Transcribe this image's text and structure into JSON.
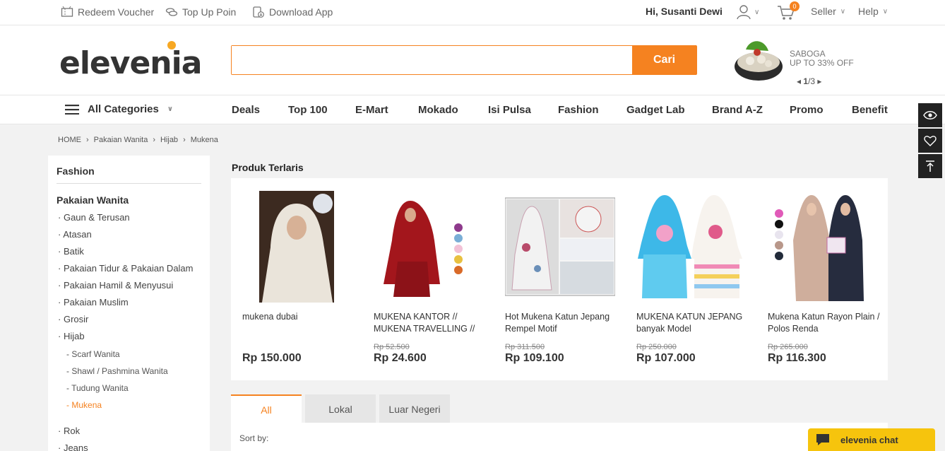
{
  "topbar": {
    "redeem": "Redeem Voucher",
    "topup": "Top Up Poin",
    "download": "Download App",
    "greeting": "Hi, Susanti Dewi",
    "cart_count": "0",
    "seller": "Seller",
    "help": "Help"
  },
  "header": {
    "logo": "eleveni",
    "logo_tail": "a",
    "search_placeholder": "",
    "search_button": "Cari",
    "promo_line1": "SABOGA",
    "promo_line2": "UP TO 33% OFF",
    "promo_page_current": "1",
    "promo_page_total": "/3"
  },
  "nav": {
    "all_categories": "All Categories",
    "links": [
      "Deals",
      "Top 100",
      "E-Mart",
      "Mokado",
      "Isi Pulsa",
      "Fashion",
      "Gadget Lab",
      "Brand A-Z",
      "Promo",
      "Benefit"
    ]
  },
  "breadcrumb": [
    "HOME",
    "Pakaian Wanita",
    "Hijab",
    "Mukena"
  ],
  "sidebar": {
    "title": "Fashion",
    "group": "Pakaian Wanita",
    "items": [
      "Gaun & Terusan",
      "Atasan",
      "Batik",
      "Pakaian Tidur & Pakaian Dalam",
      "Pakaian Hamil & Menyusui",
      "Pakaian Muslim",
      "Grosir",
      "Hijab"
    ],
    "subitems": [
      "Scarf Wanita",
      "Shawl / Pashmina Wanita",
      "Tudung Wanita",
      "Mukena"
    ],
    "more": [
      "Rok",
      "Jeans"
    ]
  },
  "section_title": "Produk Terlaris",
  "products": [
    {
      "name": "mukena dubai",
      "old_price": "",
      "price": "Rp 150.000"
    },
    {
      "name": "MUKENA KANTOR // MUKENA TRAVELLING //",
      "old_price": "Rp 52.500",
      "price": "Rp 24.600"
    },
    {
      "name": "Hot Mukena Katun Jepang Rempel Motif",
      "old_price": "Rp 311.500",
      "price": "Rp 109.100"
    },
    {
      "name": "MUKENA KATUN JEPANG banyak Model",
      "old_price": "Rp 250.000",
      "price": "Rp 107.000"
    },
    {
      "name": "Mukena Katun Rayon Plain / Polos Renda",
      "old_price": "Rp 265.000",
      "price": "Rp 116.300"
    }
  ],
  "tabs": [
    "All",
    "Lokal",
    "Luar Negeri"
  ],
  "sort_label": "Sort by:",
  "chat_label": "elevenia chat",
  "colors": {
    "accent": "#f58220",
    "chat": "#f6c40d"
  }
}
